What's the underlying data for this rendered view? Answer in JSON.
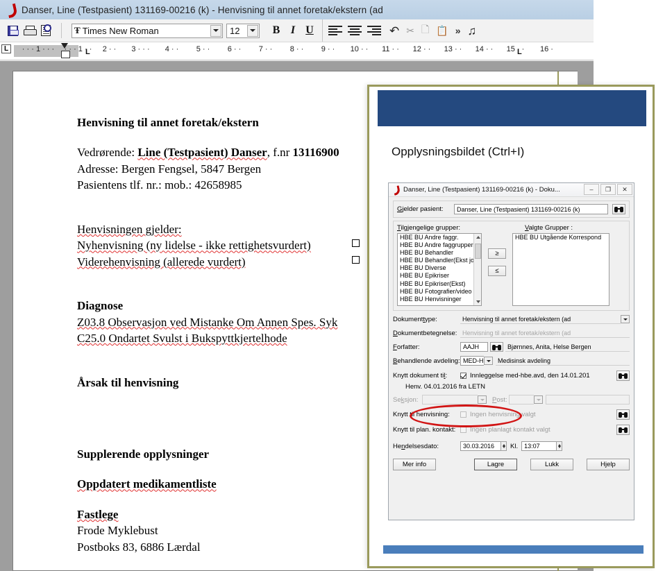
{
  "editor": {
    "title": "Danser, Line (Testpasient)  131169-00216 (k) - Henvisning til annet foretak/ekstern (ad",
    "logo_icon": "dips-logo-icon",
    "toolbar": {
      "save_icon": "save-floppy-icon",
      "print_icon": "printer-icon",
      "preview_icon": "print-preview-icon",
      "font_name": "Times New Roman",
      "font_glyph": "Ŧ",
      "font_size": "12",
      "bold_label": "B",
      "italic_label": "I",
      "underline_label": "U",
      "align_left_icon": "align-left-icon",
      "align_center_icon": "align-center-icon",
      "align_right_icon": "align-right-icon",
      "undo_icon": "undo-icon",
      "cut_icon": "cut-scissors-icon",
      "copy_icon": "copy-icon",
      "paste_icon": "paste-clipboard-icon",
      "more_label": "»",
      "dictate_icon": "speech-dictate-icon"
    },
    "ruler": {
      "corner_label": "L",
      "ticks": [
        "1",
        "1",
        "2",
        "3",
        "4",
        "5",
        "6",
        "7",
        "8",
        "9",
        "10",
        "11",
        "12",
        "13",
        "14",
        "15",
        "16"
      ],
      "tab_marks": [
        "L",
        "L",
        "L"
      ]
    }
  },
  "document": {
    "heading": "Henvisning til annet foretak/ekstern",
    "vedrorende_label": "Vedrørende: ",
    "patient_name": "Line (Testpasient) Danser",
    "fnr_label": ", f.nr ",
    "fnr_value": "13116900",
    "adresse": "Adresse: Bergen Fengsel, 5847 Bergen",
    "telefon": "Pasientens tlf. nr.: mob.: 42658985",
    "gjelder_label": "Henvisningen gjelder:",
    "option_new": "Nyhenvisning (ny lidelse - ikke rettighetsvurdert)",
    "option_further": "Viderehenvisning (allerede vurdert)",
    "diagnose_heading": "Diagnose",
    "diagnose_1": "Z03.8 Observasjon ved Mistanke Om Annen Spes. Syk",
    "diagnose_2": "C25.0 Ondartet Svulst i Bukspyttkjertelhode",
    "arsak_heading": "Årsak til henvisning",
    "supplerende_heading": "Supplerende opplysninger",
    "medikament_heading": "Oppdatert medikamentliste",
    "fastlege_heading": "Fastlege",
    "fastlege_name": "Frode Myklebust",
    "fastlege_address": "Postboks 83, 6886 Lærdal"
  },
  "overlay": {
    "caption": "Opplysningsbildet (Ctrl+I)",
    "header_color": "#24497f",
    "bottom_bar_color": "#4a7ebb",
    "border_color": "#9a9a5c"
  },
  "dialog": {
    "title": "Danser, Line (Testpasient)  131169-00216 (k) - Doku...",
    "logo_icon": "dips-logo-icon",
    "window_buttons": {
      "minimize": "–",
      "maximize": "❐",
      "close": "✕"
    },
    "patient": {
      "label": "Gjelder pasient:",
      "value": "Danser, Line (Testpasient)  131169-00216 (k)",
      "search_icon": "binoculars-search-icon"
    },
    "groups": {
      "available_label": "Tilgjengelige grupper:",
      "selected_label": "Valgte Grupper :",
      "available_items": [
        "HBE BU Andre faggr.",
        "HBE BU Andre faggruppers",
        "HBE BU Behandler",
        "HBE BU Behandler(Ekst jou.",
        "HBE BU Diverse",
        "HBE BU Epikriser",
        "HBE BU Epikriser(Ekst)",
        "HBE BU Fotografier/video",
        "HBE BU Henvisninger"
      ],
      "selected_items": [
        "HBE BU Utgående Korrespond"
      ],
      "add_label": "≥",
      "remove_label": "≤"
    },
    "fields": {
      "dokumenttype_label": "Dokumenttype:",
      "dokumenttype_value": "Henvisning til annet foretak/ekstern (ad",
      "dokumentbetegnelse_label": "Dokumentbetegnelse:",
      "dokumentbetegnelse_value": "Henvisning til annet foretak/ekstern (ad",
      "forfatter_label": "Forfatter:",
      "forfatter_code": "AAJH",
      "forfatter_name": "Bjørnnes, Anita, Helse Bergen",
      "avdeling_label": "Behandlende avdeling:",
      "avdeling_code": "MED-H",
      "avdeling_name": "Medisinsk avdeling",
      "knytt_dokument_label": "Knytt dokument til:",
      "knytt_dokument_value": "Innleggelse med-hbe.avd, den 14.01.201",
      "knytt_dokument_second": "Henv. 04.01.2016 fra LETN",
      "seksjon_label": "Seksjon:",
      "seksjon_value": "",
      "post_label": "Post:",
      "post_value": "",
      "henvisning_label": "Knytt til henvisning:",
      "henvisning_value": "Ingen henvisning valgt",
      "plan_kontakt_label": "Knytt til plan. kontakt:",
      "plan_kontakt_value": "Ingen planlagt kontakt valgt",
      "hendelsesdato_label": "Hendelsesdato:",
      "hendelsesdato_value": "30.03.2016",
      "kl_label": "Kl.",
      "kl_value": "13:07"
    },
    "buttons": {
      "mer_info": "Mer info",
      "lagre": "Lagre",
      "lukk": "Lukk",
      "hjelp": "Hjelp"
    },
    "annotation": {
      "shape": "red-ellipse-highlight",
      "color": "#d11414"
    }
  }
}
